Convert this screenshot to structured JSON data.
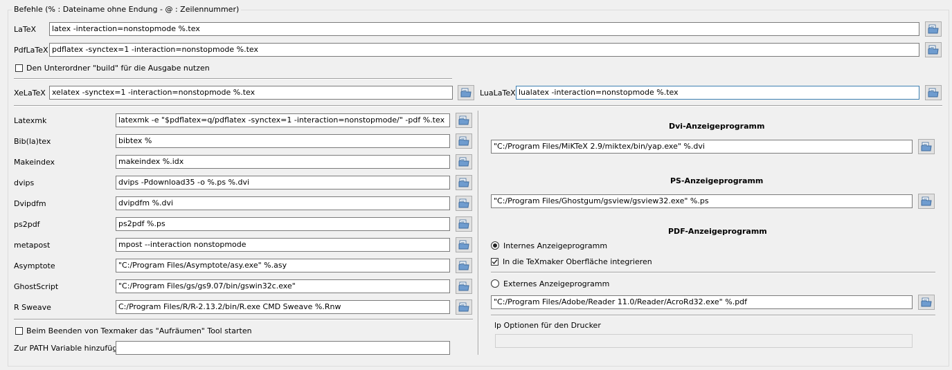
{
  "group_title": "Befehle (% : Dateiname ohne Endung - @ : Zeilennummer)",
  "latex": {
    "label": "LaTeX",
    "value": "latex -interaction=nonstopmode %.tex"
  },
  "pdflatex": {
    "label": "PdfLaTeX",
    "value": "pdflatex -synctex=1 -interaction=nonstopmode %.tex"
  },
  "build_subfolder": {
    "label": "Den Unterordner \"build\" für die Ausgabe nutzen",
    "checked": false
  },
  "xelatex": {
    "label": "XeLaTeX",
    "value": "xelatex -synctex=1 -interaction=nonstopmode %.tex"
  },
  "lualatex": {
    "label": "LuaLaTeX",
    "value": "lualatex -interaction=nonstopmode %.tex"
  },
  "tools": [
    {
      "label": "Latexmk",
      "value": "latexmk -e \"$pdflatex=q/pdflatex -synctex=1 -interaction=nonstopmode/\" -pdf %.tex"
    },
    {
      "label": "Bib(la)tex",
      "value": "bibtex %"
    },
    {
      "label": "Makeindex",
      "value": "makeindex %.idx"
    },
    {
      "label": "dvips",
      "value": "dvips -Pdownload35 -o %.ps %.dvi"
    },
    {
      "label": "Dvipdfm",
      "value": "dvipdfm %.dvi"
    },
    {
      "label": "ps2pdf",
      "value": "ps2pdf %.ps"
    },
    {
      "label": "metapost",
      "value": "mpost --interaction nonstopmode"
    },
    {
      "label": "Asymptote",
      "value": "\"C:/Program Files/Asymptote/asy.exe\" %.asy"
    },
    {
      "label": "GhostScript",
      "value": "\"C:/Program Files/gs/gs9.07/bin/gswin32c.exe\""
    },
    {
      "label": "R Sweave",
      "value": "C:/Program Files/R/R-2.13.2/bin/R.exe CMD Sweave %.Rnw"
    }
  ],
  "cleanup": {
    "label": "Beim Beenden von Texmaker das \"Aufräumen\" Tool starten",
    "checked": false
  },
  "path_var": {
    "label": "Zur PATH Variable hinzufügen",
    "value": ""
  },
  "dvi_viewer": {
    "heading": "Dvi-Anzeigeprogramm",
    "value": "\"C:/Program Files/MiKTeX 2.9/miktex/bin/yap.exe\" %.dvi"
  },
  "ps_viewer": {
    "heading": "PS-Anzeigeprogramm",
    "value": "\"C:/Program Files/Ghostgum/gsview/gsview32.exe\" %.ps"
  },
  "pdf_viewer": {
    "heading": "PDF-Anzeigeprogramm",
    "internal_label": "Internes Anzeigeprogramm",
    "internal_selected": true,
    "integrate_label": "In die TeXmaker Oberfläche integrieren",
    "integrate_checked": true,
    "external_label": "Externes Anzeigeprogramm",
    "external_value": "\"C:/Program Files/Adobe/Reader 11.0/Reader/AcroRd32.exe\" %.pdf"
  },
  "lp_options": {
    "label": "lp Optionen für den Drucker",
    "value": ""
  },
  "icons": {
    "browse": "open-folder-icon",
    "check": "checkmark-icon"
  }
}
